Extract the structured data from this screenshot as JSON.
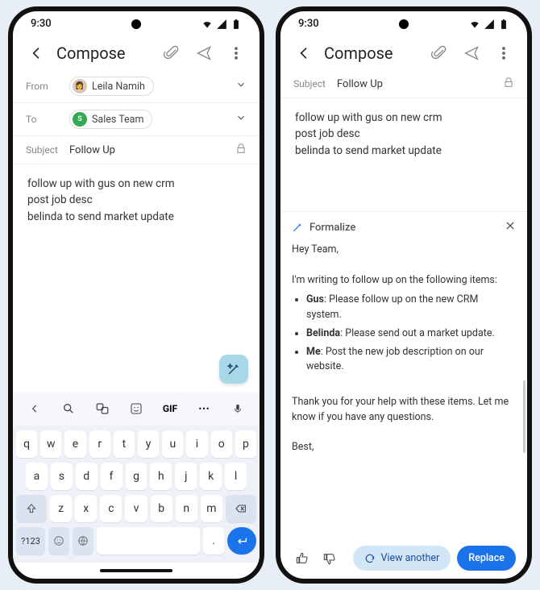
{
  "status": {
    "time": "9:30"
  },
  "appbar": {
    "title": "Compose"
  },
  "fields": {
    "from_label": "From",
    "from_name": "Leila Namih",
    "to_label": "To",
    "to_name": "Sales Team",
    "to_initial": "S",
    "subject_label": "Subject",
    "subject_value": "Follow Up"
  },
  "body_lines": {
    "l1": "follow up with gus on new crm",
    "l2": "post job desc",
    "l3": "belinda to send market update"
  },
  "keyboard": {
    "gif": "GIF",
    "row1": {
      "k0": "q",
      "k1": "w",
      "k2": "e",
      "k3": "r",
      "k4": "t",
      "k5": "y",
      "k6": "u",
      "k7": "i",
      "k8": "o",
      "k9": "p"
    },
    "row2": {
      "k0": "a",
      "k1": "s",
      "k2": "d",
      "k3": "f",
      "k4": "g",
      "k5": "h",
      "k6": "j",
      "k7": "k",
      "k8": "l"
    },
    "row3": {
      "k0": "z",
      "k1": "x",
      "k2": "c",
      "k3": "v",
      "k4": "b",
      "k5": "n",
      "k6": "m"
    },
    "symkey": "?123",
    "comma": ",",
    "period": "."
  },
  "panel": {
    "title": "Formalize",
    "greeting": "Hey Team,",
    "intro": "I'm writing to follow up on the following items:",
    "b1_name": "Gus",
    "b1_text": ": Please follow up on the new CRM system.",
    "b2_name": "Belinda",
    "b2_text": ": Please send out a market update.",
    "b3_name": "Me",
    "b3_text": ": Post the new job description on our website.",
    "thanks": "Thank you for your help with these items. Let me know if you have any questions.",
    "signoff": "Best,",
    "view_another": "View another",
    "replace": "Replace"
  }
}
